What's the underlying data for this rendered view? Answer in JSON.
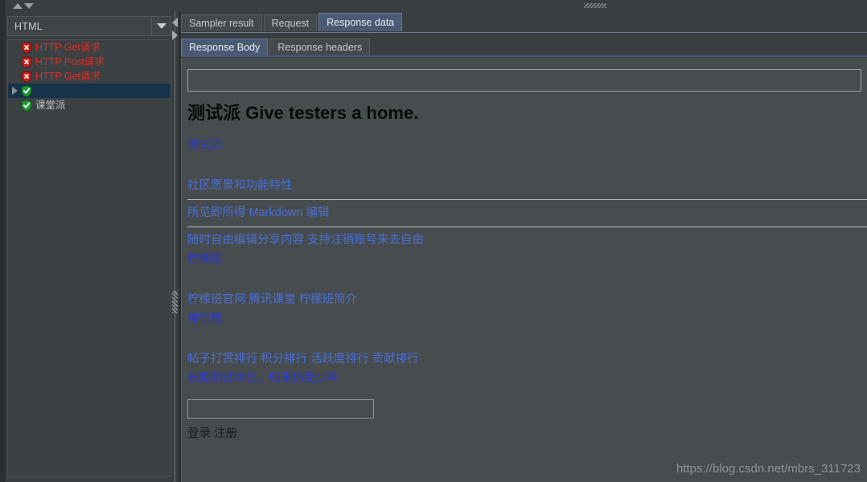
{
  "window": {
    "top_grip": "drag-handle"
  },
  "left_panel": {
    "nav_up_label": "▲",
    "nav_down_label": "▼",
    "combo": {
      "value": "HTML",
      "arrow": "chevron-down-icon"
    },
    "tree_items": [
      {
        "label": "HTTP Get请求",
        "status": "error",
        "icon": "error-shield-icon",
        "selected": false,
        "expander": false
      },
      {
        "label": "HTTP Post请求",
        "status": "error",
        "icon": "error-shield-icon",
        "selected": false,
        "expander": false
      },
      {
        "label": "HTTP Get请求",
        "status": "error",
        "icon": "error-shield-icon",
        "selected": false,
        "expander": false
      },
      {
        "label": "",
        "status": "ok",
        "icon": "success-shield-icon",
        "selected": true,
        "expander": true
      },
      {
        "label": "课堂派",
        "status": "ok",
        "icon": "success-shield-icon",
        "selected": false,
        "expander": false
      }
    ]
  },
  "splitter": {
    "collapse_left": "caret-left-icon",
    "collapse_right": "caret-right-icon",
    "grip": "splitter-grip"
  },
  "right_panel": {
    "tabs": [
      {
        "label": "Sampler result",
        "active": false
      },
      {
        "label": "Request",
        "active": false
      },
      {
        "label": "Response data",
        "active": true
      }
    ],
    "subtabs": [
      {
        "label": "Response Body",
        "active": true
      },
      {
        "label": "Response headers",
        "active": false
      }
    ],
    "response_body": {
      "heading": "测试派 Give testers a home.",
      "link_site": "测试派",
      "section_features": "社区愿景和功能特性",
      "section_markdown": "所见即所得 Markdown 编辑",
      "line_edit_share": "随时自由编辑分享内容 支持注销账号来去自由",
      "link_lemon": "柠檬班",
      "line_lemon_links": "柠檬班官网 腾讯课堂 柠檬班简介",
      "link_ranking": "排行榜",
      "line_ranking_links": "帖子打赏排行 积分排行 活跃度排行 贡献排行",
      "line_slogan": "长歌测试半生，归来仍是少年",
      "search_value": "",
      "footer_links": "登录 注册"
    }
  },
  "watermark": "https://blog.csdn.net/mbrs_311723",
  "colors": {
    "app_bg": "#393e41",
    "content_bg": "#474c4f",
    "tab_active": "#4a5a75",
    "tree_selected": "#17324b",
    "error_text": "#e02b20",
    "link_blue": "#2b37d8",
    "link_soft": "#4a6fd4",
    "heading_black": "#0b0b0b"
  }
}
